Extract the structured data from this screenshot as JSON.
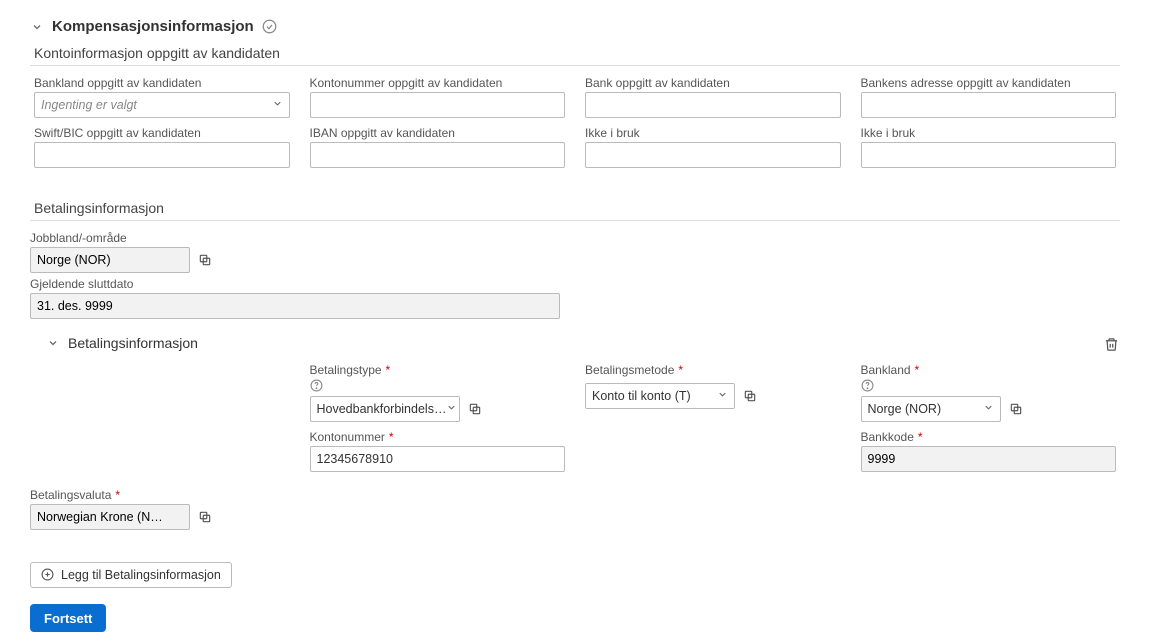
{
  "header": {
    "title": "Kompensasjonsinformasjon"
  },
  "candidate_account": {
    "section_title": "Kontoinformasjon oppgitt av kandidaten",
    "bank_country_label": "Bankland oppgitt av kandidaten",
    "bank_country_placeholder": "Ingenting er valgt",
    "account_number_label": "Kontonummer oppgitt av kandidaten",
    "bank_label": "Bank oppgitt av kandidaten",
    "bank_address_label": "Bankens adresse oppgitt av kandidaten",
    "swift_label": "Swift/BIC oppgitt av kandidaten",
    "iban_label": "IBAN oppgitt av kandidaten",
    "unused_label": "Ikke i bruk"
  },
  "payment": {
    "section_title": "Betalingsinformasjon",
    "job_country_label": "Jobbland/-område",
    "job_country_value": "Norge (NOR)",
    "end_date_label": "Gjeldende sluttdato",
    "end_date_value": "31. des. 9999",
    "inner_title": "Betalingsinformasjon",
    "pay_type_label": "Betalingstype",
    "pay_type_value": "Hovedbankforbindels…",
    "pay_method_label": "Betalingsmetode",
    "pay_method_value": "Konto til konto (T)",
    "bank_country_label": "Bankland",
    "bank_country_value": "Norge (NOR)",
    "account_number_label": "Kontonummer",
    "account_number_value": "12345678910",
    "bank_code_label": "Bankkode",
    "bank_code_value": "9999",
    "currency_label": "Betalingsvaluta",
    "currency_value": "Norwegian Krone (N…",
    "add_button": "Legg til Betalingsinformasjon",
    "continue_button": "Fortsett"
  }
}
